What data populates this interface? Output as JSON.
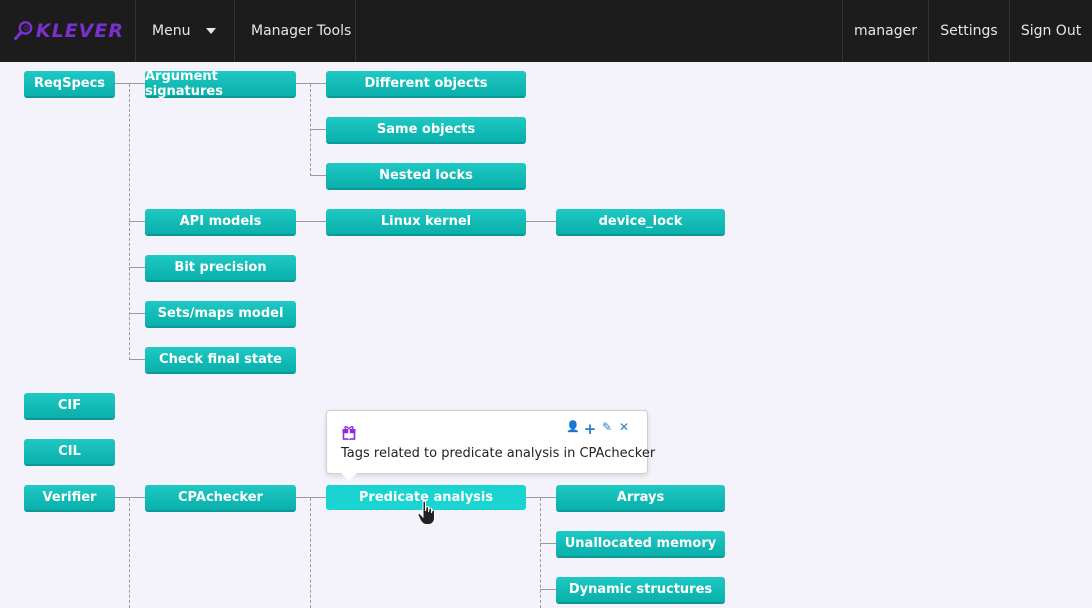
{
  "navbar": {
    "logo_text": "KLEVER",
    "menu_label": "Menu",
    "manager_tools_label": "Manager Tools",
    "user_label": "manager",
    "settings_label": "Settings",
    "sign_out_label": "Sign Out"
  },
  "tree": {
    "reqspecs": "ReqSpecs",
    "argument_signatures": "Argument signatures",
    "different_objects": "Different objects",
    "same_objects": "Same objects",
    "nested_locks": "Nested locks",
    "api_models": "API models",
    "linux_kernel": "Linux kernel",
    "device_lock": "device_lock",
    "bit_precision": "Bit precision",
    "sets_maps_model": "Sets/maps model",
    "check_final_state": "Check final state",
    "cif": "CIF",
    "cil": "CIL",
    "verifier": "Verifier",
    "cpachecker": "CPAchecker",
    "predicate_analysis": "Predicate analysis",
    "arrays": "Arrays",
    "unallocated_memory": "Unallocated memory",
    "dynamic_structures": "Dynamic structures"
  },
  "popover": {
    "description": "Tags related to predicate analysis in CPAchecker",
    "action_user": "👤",
    "action_add": "+",
    "action_edit": "✎",
    "action_close": "✕"
  },
  "colors": {
    "tag": "#0ab0ab",
    "navbar": "#1c1c1c",
    "logo": "#7b2fd0",
    "action": "#2a7fc7"
  }
}
